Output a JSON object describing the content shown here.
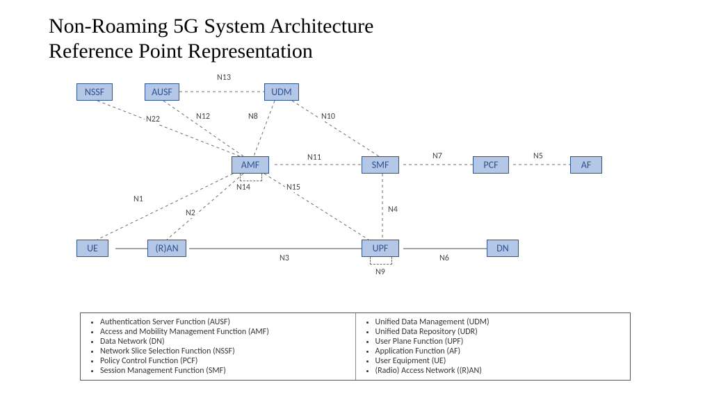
{
  "title_line1": "Non-Roaming 5G System Architecture",
  "title_line2": "Reference Point Representation",
  "nodes": {
    "nssf": "NSSF",
    "ausf": "AUSF",
    "udm": "UDM",
    "amf": "AMF",
    "smf": "SMF",
    "pcf": "PCF",
    "af": "AF",
    "ue": "UE",
    "ran": "(R)AN",
    "upf": "UPF",
    "dn": "DN"
  },
  "links": {
    "n1": "N1",
    "n2": "N2",
    "n3": "N3",
    "n4": "N4",
    "n5": "N5",
    "n6": "N6",
    "n7": "N7",
    "n8": "N8",
    "n9": "N9",
    "n10": "N10",
    "n11": "N11",
    "n12": "N12",
    "n13": "N13",
    "n14": "N14",
    "n15": "N15",
    "n22": "N22"
  },
  "legend_left": [
    "Authentication Server Function (AUSF)",
    "Access and Mobility Management Function (AMF)",
    "Data Network (DN)",
    "Network Slice Selection Function (NSSF)",
    "Policy Control Function (PCF)",
    "Session Management Function (SMF)"
  ],
  "legend_right": [
    "Unified Data Management (UDM)",
    "Unified Data Repository (UDR)",
    "User Plane Function (UPF)",
    "Application Function (AF)",
    "User Equipment (UE)",
    "(Radio) Access Network ((R)AN)"
  ]
}
